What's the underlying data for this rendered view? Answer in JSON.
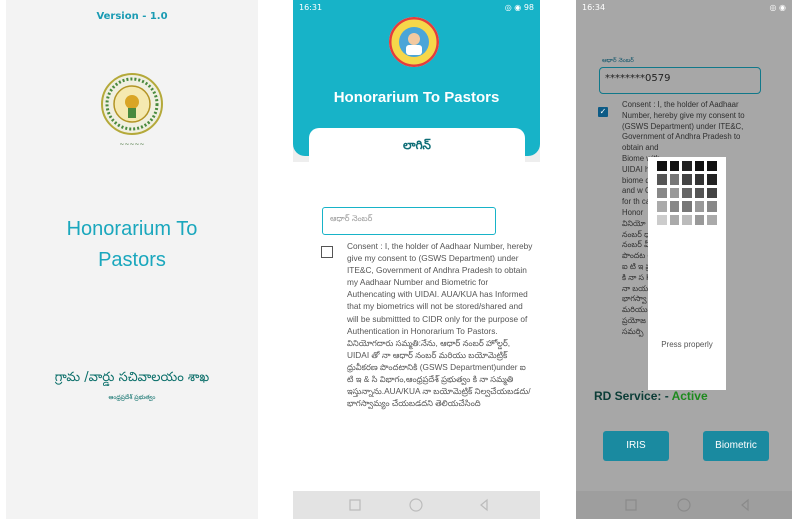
{
  "splash": {
    "version": "Version - 1.0",
    "title_line1": "Honorarium To",
    "title_line2": "Pastors",
    "dept": "గ్రామ /వార్డు సచివాలయం శాఖ",
    "state": "ఆంధ్రప్రదేశ్ ప్రభుత్వం"
  },
  "login": {
    "status_time": "16:31",
    "status_right": "◎ ◉ 98",
    "header_title": "Honorarium To Pastors",
    "tab_label": "లాగిన్",
    "aadhaar_placeholder": "ఆధార్ నెంబర్",
    "consent_en": "Consent : I, the holder of Aadhaar Number, hereby give my consent to (GSWS Department) under ITE&C, Government of Andhra Pradesh to obtain my Aadhaar Number and Biometric for Authencating with UIDAI. AUA/KUA has Informed that my biometrics will not be stored/shared and will be submittted to CIDR only for the purpose of Authentication in Honorarium To Pastors.",
    "consent_te": "వినియోగదారు సమ్మతి:నేను, ఆధార్ నంబర్ హోల్డర్, UIDAI తో నా ఆధార్ నంబర్ మరియు బయోమెట్రిక్ ధ్రువీకరణ పొందటానికి (GSWS Department)under ఐ టి ఇ & సి విభాగం,ఆంధ్రప్రదేశ్ ప్రభుత్వం కి నా సమ్మతి ఇస్తున్నాను.AUA/KUA నా బయోమెట్రిక్ నిల్వచేయబడదు/ భాగస్వామ్యం చేయబడదని తెలియచేసింది"
  },
  "biometric": {
    "status_time": "16:34",
    "status_right": "◎ ◉",
    "field_label": "ఆధార్ నెంబర్",
    "aadhaar_value": "********0579",
    "consent_lines": [
      "Consent : I, the holder of Aadhaar",
      "Number, hereby give my consent to",
      "(GSWS Department) under ITE&C,",
      "Government of Andhra Pradesh to",
      "obtain                        and",
      "Biome                        with",
      "UIDAI                  hed that my",
      "biome                  d/shared",
      "and w                  CIDR only",
      "for th                  cation in",
      "Honor",
      "వినియో                  ధార్",
      "నంబర్                  ధార్",
      "నంబర్                  వీకరణ",
      "పొందట                  ent)under",
      "ఐ టి ఇ                  ప్రభుత్వం",
      "కి నా స                  KUA",
      "నా బయ                  o/",
      "భాగస్వా                  యచేసింది",
      "మరియు                  tors",
      "ప్రయోజ                  DR కు",
      "సమర్పి"
    ],
    "rd_label": "RD Service: - ",
    "rd_status": "Active",
    "iris_label": "IRIS",
    "biometric_label": "Biometric",
    "popup_text": "Press properly"
  }
}
